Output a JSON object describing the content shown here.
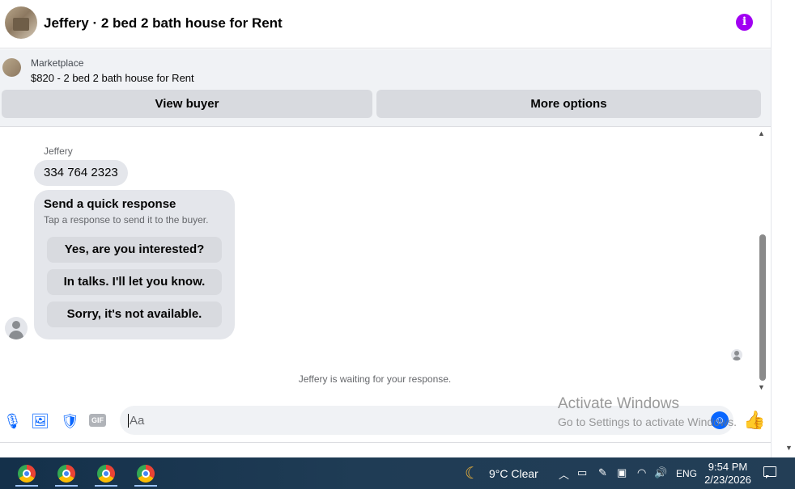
{
  "header": {
    "title": "Jeffery · 2 bed 2 bath house for Rent",
    "info_icon": "i"
  },
  "marketplace": {
    "label": "Marketplace",
    "listing": "$820 - 2 bed 2 bath house for Rent",
    "view_buyer_label": "View buyer",
    "more_options_label": "More options"
  },
  "chat": {
    "sender_name": "Jeffery",
    "message": "334 764 2323",
    "quick_response": {
      "title": "Send a quick response",
      "subtitle": "Tap a response to send it to the buyer.",
      "options": [
        "Yes, are you interested?",
        "In talks. I'll let you know.",
        "Sorry, it's not available."
      ]
    },
    "status": "Jeffery is waiting for your response."
  },
  "composer": {
    "placeholder": "Aa",
    "gif_label": "GIF"
  },
  "watermark": {
    "title": "Activate Windows",
    "subtitle": "Go to Settings to activate Windows."
  },
  "taskbar": {
    "weather": "9°C  Clear",
    "language": "ENG",
    "time": "9:54 PM",
    "date": "2/23/2026"
  },
  "colors": {
    "accent": "#0866ff",
    "info": "#a100f2",
    "bubble": "#e4e6eb"
  }
}
